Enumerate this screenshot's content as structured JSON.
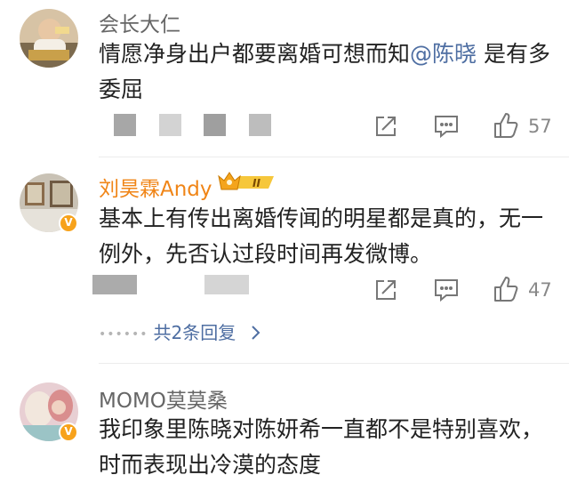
{
  "comments": [
    {
      "username": "会长大仁",
      "text_before_mention": "情愿净身出户都要离婚可想而知",
      "mention": "@陈晓",
      "text_after_mention": " 是有多委屈",
      "likes": "57",
      "icons": [
        "share-icon",
        "reply-icon",
        "like-icon"
      ]
    },
    {
      "username": "刘昊霖Andy",
      "badge_level": "II",
      "text": "基本上有传出离婚传闻的明星都是真的，无一例外，先否认过段时间再发微博。",
      "likes": "47",
      "replies_label": "共2条回复",
      "replies_dots": "••••••",
      "icons": [
        "share-icon",
        "reply-icon",
        "like-icon",
        "chevron-right-icon"
      ]
    },
    {
      "username": "MOMO莫莫桑",
      "text": "我印象里陈晓对陈妍希一直都不是特别喜欢，时而表现出冷漠的态度",
      "icons": []
    }
  ],
  "colors": {
    "mention": "#4e6ea2",
    "vip_name": "#f08517",
    "badge": "#f7a21b"
  }
}
